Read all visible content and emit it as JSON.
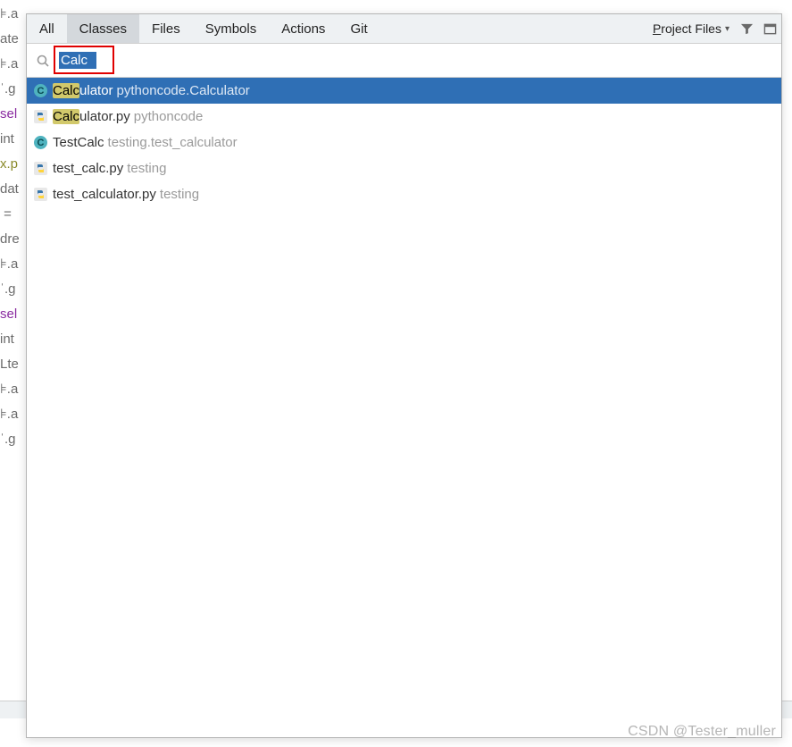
{
  "bg_code": [
    {
      "t": "⊧.a",
      "cls": "c-grey"
    },
    {
      "t": "",
      "cls": ""
    },
    {
      "t": "",
      "cls": ""
    },
    {
      "t": "ate",
      "cls": "c-grey"
    },
    {
      "t": "⊧.a",
      "cls": "c-grey"
    },
    {
      "t": "ˈ.g",
      "cls": "c-grey"
    },
    {
      "t": "",
      "cls": ""
    },
    {
      "t": "sel",
      "cls": "c-purple"
    },
    {
      "t": "int",
      "cls": "c-grey"
    },
    {
      "t": "",
      "cls": ""
    },
    {
      "t": "",
      "cls": ""
    },
    {
      "t": "x.p",
      "cls": "c-olive"
    },
    {
      "t": "dat",
      "cls": "c-grey"
    },
    {
      "t": " =",
      "cls": "c-grey"
    },
    {
      "t": "dre",
      "cls": "c-grey"
    },
    {
      "t": "⊧.a",
      "cls": "c-grey"
    },
    {
      "t": "ˈ.g",
      "cls": "c-grey"
    },
    {
      "t": "",
      "cls": ""
    },
    {
      "t": "",
      "cls": ""
    },
    {
      "t": "sel",
      "cls": "c-purple"
    },
    {
      "t": "int",
      "cls": "c-grey"
    },
    {
      "t": "",
      "cls": ""
    },
    {
      "t": "",
      "cls": ""
    },
    {
      "t": "Lte",
      "cls": "c-grey"
    },
    {
      "t": "⊧.a",
      "cls": "c-grey"
    },
    {
      "t": "⊧.a",
      "cls": "c-grey"
    },
    {
      "t": "ˈ.g",
      "cls": "c-grey"
    }
  ],
  "tabs": [
    {
      "label": "All"
    },
    {
      "label": "Classes",
      "active": true
    },
    {
      "label": "Files"
    },
    {
      "label": "Symbols"
    },
    {
      "label": "Actions"
    },
    {
      "label": "Git"
    }
  ],
  "scope": {
    "prefix": "P",
    "rest": "roject Files"
  },
  "search": {
    "value": "Calc"
  },
  "results": [
    {
      "icon": "class-c",
      "hl": "Calc",
      "name": "ulator",
      "loc": "pythoncode.Calculator",
      "selected": true
    },
    {
      "icon": "py",
      "hl": "Calc",
      "name": "ulator.py",
      "loc": "pythoncode"
    },
    {
      "icon": "class-c",
      "hl": "",
      "name": "TestCalc",
      "loc": "testing.test_calculator"
    },
    {
      "icon": "py",
      "hl": "",
      "name": "test_calc.py",
      "loc": "testing"
    },
    {
      "icon": "py",
      "hl": "",
      "name": "test_calculator.py",
      "loc": "testing"
    }
  ],
  "watermark": "CSDN @Tester_muller"
}
